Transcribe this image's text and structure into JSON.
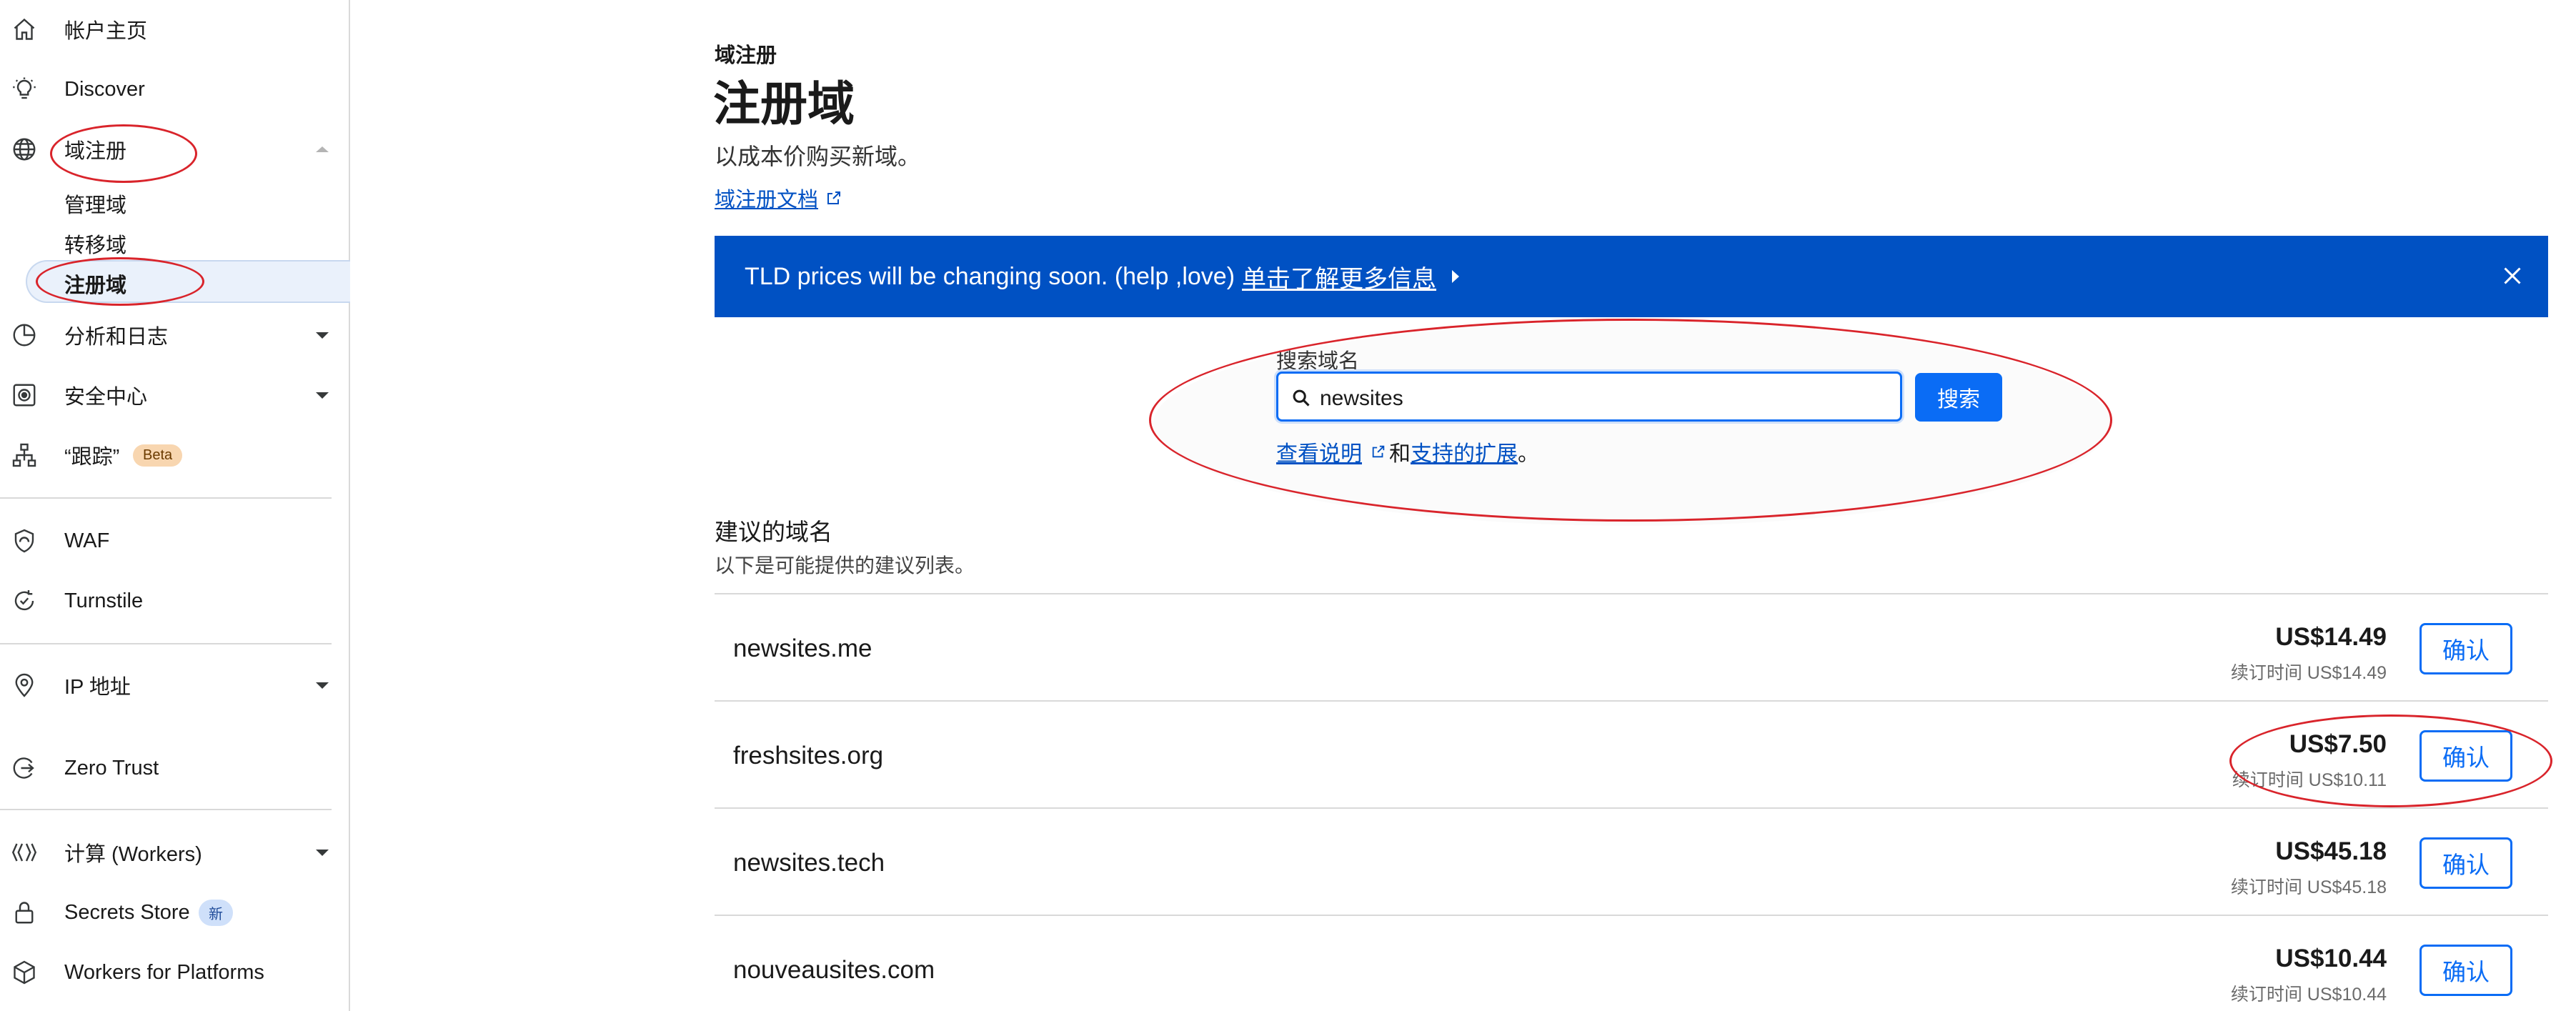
{
  "sidebar": {
    "items": [
      {
        "label": "帐户主页",
        "icon": "home-icon"
      },
      {
        "label": "Discover",
        "icon": "lightbulb-icon"
      },
      {
        "label": "域注册",
        "icon": "globe-icon"
      },
      {
        "label": "分析和日志",
        "icon": "chart-pie-icon"
      },
      {
        "label": "安全中心",
        "icon": "security-center-icon"
      },
      {
        "label": "“跟踪”",
        "icon": "trace-icon",
        "badge": "Beta"
      },
      {
        "label": "WAF",
        "icon": "waf-shield-icon"
      },
      {
        "label": "Turnstile",
        "icon": "turnstile-icon"
      },
      {
        "label": "IP 地址",
        "icon": "location-pin-icon"
      },
      {
        "label": "Zero Trust",
        "icon": "zero-trust-icon"
      },
      {
        "label": "计算 (Workers)",
        "icon": "workers-icon"
      },
      {
        "label": "Secrets Store",
        "icon": "lock-icon",
        "badge": "新"
      },
      {
        "label": "Workers for Platforms",
        "icon": "cube-icon"
      }
    ],
    "sub_items": [
      "管理域",
      "转移域",
      "注册域"
    ]
  },
  "header": {
    "breadcrumb": "域注册",
    "title": "注册域",
    "subtitle": "以成本价购买新域。",
    "doc_link": "域注册文档"
  },
  "banner": {
    "text": "TLD prices will be changing soon. (help ,love)",
    "link": "单击了解更多信息"
  },
  "search": {
    "label": "搜索域名",
    "value": "newsites",
    "button": "搜索",
    "help_link1": "查看说明",
    "help_and": "和",
    "help_link2": "支持的扩展",
    "help_end": "。"
  },
  "suggestions": {
    "title": "建议的域名",
    "description": "以下是可能提供的建议列表。",
    "rows": [
      {
        "domain": "newsites.me",
        "price": "US$14.49",
        "renew": "续订时间 US$14.49",
        "button": "确认"
      },
      {
        "domain": "freshsites.org",
        "price": "US$7.50",
        "renew": "续订时间 US$10.11",
        "button": "确认"
      },
      {
        "domain": "newsites.tech",
        "price": "US$45.18",
        "renew": "续订时间 US$45.18",
        "button": "确认"
      },
      {
        "domain": "nouveausites.com",
        "price": "US$10.44",
        "renew": "续订时间 US$10.44",
        "button": "确认"
      }
    ]
  },
  "colors": {
    "accent": "#0a6cf5",
    "banner": "#0051c3",
    "annotation": "#d9242b"
  }
}
